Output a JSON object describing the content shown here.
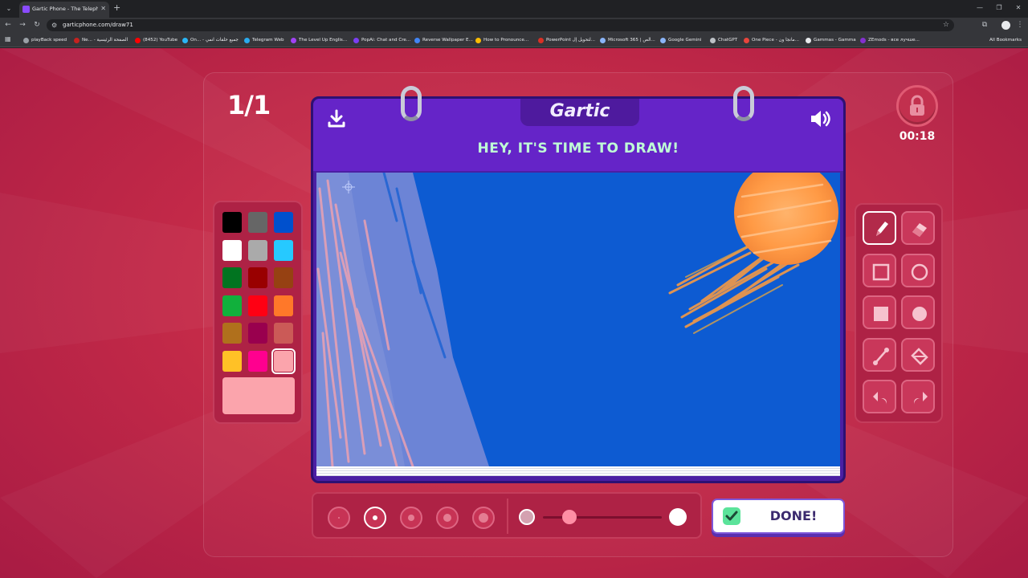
{
  "browser": {
    "tab_title": "Gartic Phone - The Telephone Ga...",
    "url": "garticphone.com/draw71",
    "bookmarks": [
      {
        "label": "playBack speed",
        "color": "#9aa0a6"
      },
      {
        "label": "Ne... - الصفحة الرئيسية",
        "color": "#c5221f"
      },
      {
        "label": "(8452) YouTube",
        "color": "#ff0000"
      },
      {
        "label": "On... - جميع حلقات انمي",
        "color": "#29b6f6"
      },
      {
        "label": "Telegram Web",
        "color": "#2aabee"
      },
      {
        "label": "The Level Up Englis...",
        "color": "#a142f4"
      },
      {
        "label": "PopAi: Chat and Cre...",
        "color": "#7b3ff2"
      },
      {
        "label": "Reverse Wallpaper E...",
        "color": "#4285f4"
      },
      {
        "label": "How to Pronounce...",
        "color": "#fbbc04"
      },
      {
        "label": "PowerPoint لتحويل إل...",
        "color": "#d93025"
      },
      {
        "label": "Microsoft 365 | الص...",
        "color": "#8ab4f8"
      },
      {
        "label": "Google Gemini",
        "color": "#8ab4f8"
      },
      {
        "label": "ChatGPT",
        "color": "#bdc1c6"
      },
      {
        "label": "One Piece - مانجا ون...",
        "color": "#e8453c"
      },
      {
        "label": "Gammas - Gamma",
        "color": "#e8eaed"
      },
      {
        "label": "ZEmods - все лучше...",
        "color": "#8430ce"
      }
    ],
    "all_bookmarks_label": "All Bookmarks"
  },
  "game": {
    "round_counter": "1/1",
    "timer": "00:18",
    "logo": "Gartic",
    "instruction": "HEY, IT'S TIME TO DRAW!",
    "done_label": "DONE!",
    "selected_color": "#fba4ac",
    "colors": [
      "#000000",
      "#666666",
      "#0050cd",
      "#ffffff",
      "#aaaaaa",
      "#26c9ff",
      "#017420",
      "#990000",
      "#964112",
      "#11b03c",
      "#ff0013",
      "#ff7829",
      "#b0701c",
      "#99004e",
      "#cb5a57",
      "#ffc126",
      "#ff008f",
      "#fba4ac"
    ],
    "tools": [
      {
        "name": "pencil",
        "icon": "pencil-icon",
        "selected": true
      },
      {
        "name": "eraser",
        "icon": "eraser-icon",
        "selected": false
      },
      {
        "name": "rectangle",
        "icon": "rectangle-outline-icon",
        "selected": false
      },
      {
        "name": "ellipse",
        "icon": "ellipse-outline-icon",
        "selected": false
      },
      {
        "name": "filled-rectangle",
        "icon": "rectangle-filled-icon",
        "selected": false
      },
      {
        "name": "filled-ellipse",
        "icon": "ellipse-filled-icon",
        "selected": false
      },
      {
        "name": "line",
        "icon": "line-icon",
        "selected": false
      },
      {
        "name": "fill",
        "icon": "bucket-icon",
        "selected": false
      },
      {
        "name": "undo",
        "icon": "undo-icon",
        "selected": false
      },
      {
        "name": "redo",
        "icon": "redo-icon",
        "selected": false
      }
    ],
    "brush_size_selected_index": 1,
    "opacity_fraction": 0.22
  }
}
